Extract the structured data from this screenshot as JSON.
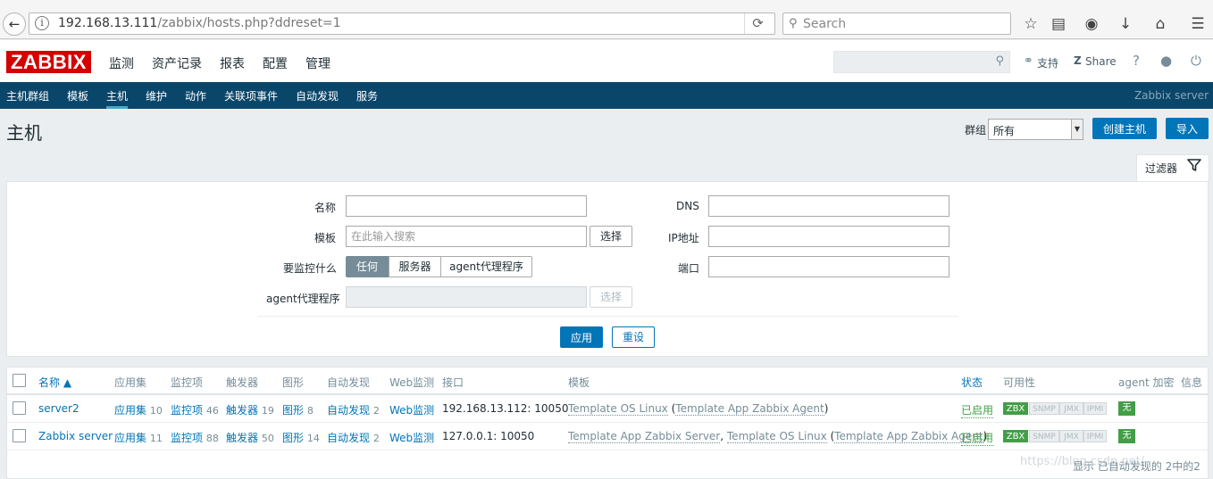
{
  "browser": {
    "url_host": "192.168.13.111",
    "url_path": "/zabbix/hosts.php?ddreset=1",
    "search_placeholder": "Search"
  },
  "header": {
    "logo": "ZABBIX",
    "menu": [
      "监测",
      "资产记录",
      "报表",
      "配置",
      "管理"
    ],
    "support": "支持",
    "share": "Share",
    "help": "?"
  },
  "submenu": {
    "items": [
      "主机群组",
      "模板",
      "主机",
      "维护",
      "动作",
      "关联项事件",
      "自动发现",
      "服务"
    ],
    "selected": "主机",
    "server_name": "Zabbix server"
  },
  "page": {
    "title": "主机",
    "group_label": "群组",
    "group_value": "所有",
    "create_button": "创建主机",
    "import_button": "导入"
  },
  "filter": {
    "tab_label": "过滤器",
    "name_label": "名称",
    "template_label": "模板",
    "template_placeholder": "在此输入搜索",
    "select_button": "选择",
    "monitored_by_label": "要监控什么",
    "monitored_options": [
      "任何",
      "服务器",
      "agent代理程序"
    ],
    "proxy_label": "agent代理程序",
    "proxy_select_button": "选择",
    "dns_label": "DNS",
    "ip_label": "IP地址",
    "port_label": "端口",
    "apply_button": "应用",
    "reset_button": "重设"
  },
  "table": {
    "columns": [
      "名称 ▲",
      "应用集",
      "监控项",
      "触发器",
      "图形",
      "自动发现",
      "Web监测",
      "接口",
      "模板",
      "状态",
      "可用性",
      "agent 加密",
      "信息"
    ],
    "rows": [
      {
        "name": "server2",
        "apps": "应用集",
        "apps_count": "10",
        "items": "监控项",
        "items_count": "46",
        "triggers": "触发器",
        "triggers_count": "19",
        "graphs": "图形",
        "graphs_count": "8",
        "discovery": "自动发现",
        "discovery_count": "2",
        "web": "Web监测",
        "interface": "192.168.13.112: 10050",
        "tpl_main": "Template OS Linux",
        "tpl_paren": "Template App Zabbix Agent",
        "status": "已启用",
        "avail": [
          "ZBX",
          "SNMP",
          "JMX",
          "IPMI"
        ],
        "encryption": "无"
      },
      {
        "name": "Zabbix server",
        "apps": "应用集",
        "apps_count": "11",
        "items": "监控项",
        "items_count": "88",
        "triggers": "触发器",
        "triggers_count": "50",
        "graphs": "图形",
        "graphs_count": "14",
        "discovery": "自动发现",
        "discovery_count": "2",
        "web": "Web监测",
        "interface": "127.0.0.1: 10050",
        "tpl_main": "Template App Zabbix Server",
        "tpl_second": "Template OS Linux",
        "tpl_paren": "Template App Zabbix Agent",
        "status": "已启用",
        "avail": [
          "ZBX",
          "SNMP",
          "JMX",
          "IPMI"
        ],
        "encryption": "无"
      }
    ],
    "footer": "显示 已自动发现的 2中的2"
  },
  "watermark": "https://blog.csdn.net/...",
  "colors": {
    "brand": "#d40000",
    "nav": "#0a466a",
    "accent": "#0275b8",
    "enabled": "#429e47"
  }
}
